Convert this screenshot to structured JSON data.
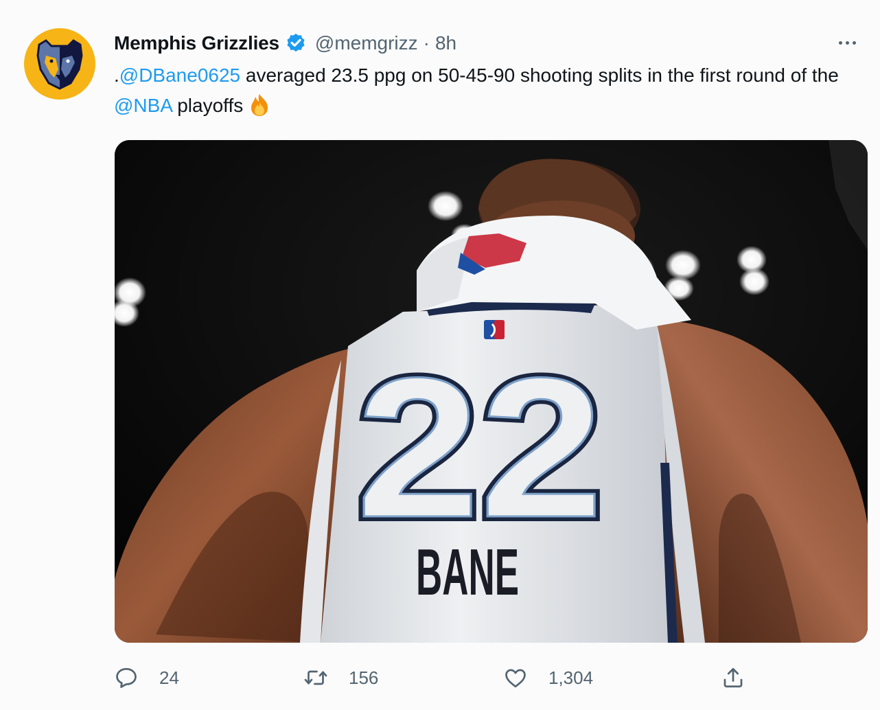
{
  "account": {
    "display_name": "Memphis Grizzlies",
    "handle": "@memgrizz",
    "separator": "·",
    "time": "8h",
    "verified": true,
    "avatar_icon": "grizzlies-logo-icon",
    "brand_color": "#f6b417"
  },
  "tweet": {
    "prefix": ".",
    "mention_player": "@DBane0625",
    "text_a": " averaged 23.5 ppg on 50-45-90 shooting splits in the first round of the ",
    "mention_league": "@NBA",
    "text_b": " playoffs",
    "emoji": "fire-emoji",
    "link_color": "#1d9bf0"
  },
  "media": {
    "jersey_number": "22",
    "jersey_name": "BANE"
  },
  "actions": {
    "replies": "24",
    "retweets": "156",
    "likes": "1,304"
  },
  "icons": {
    "reply": "reply-icon",
    "retweet": "retweet-icon",
    "like": "heart-icon",
    "share": "share-icon",
    "more": "more-icon"
  }
}
